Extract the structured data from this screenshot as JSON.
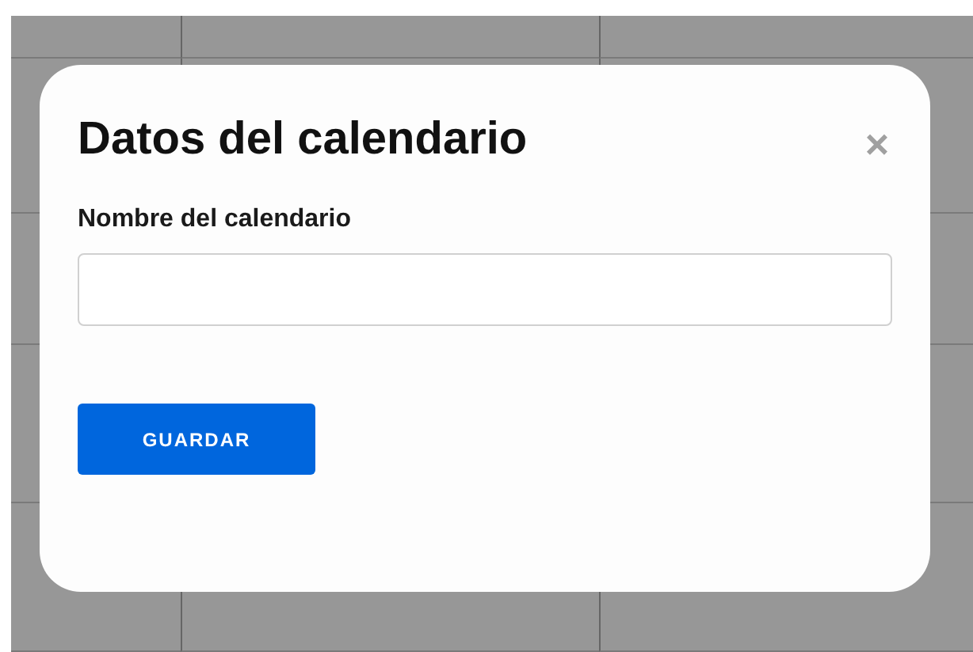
{
  "dialog": {
    "title": "Datos del calendario",
    "close": "×",
    "field": {
      "label": "Nombre del calendario"
    },
    "button": "GUARDAR"
  }
}
